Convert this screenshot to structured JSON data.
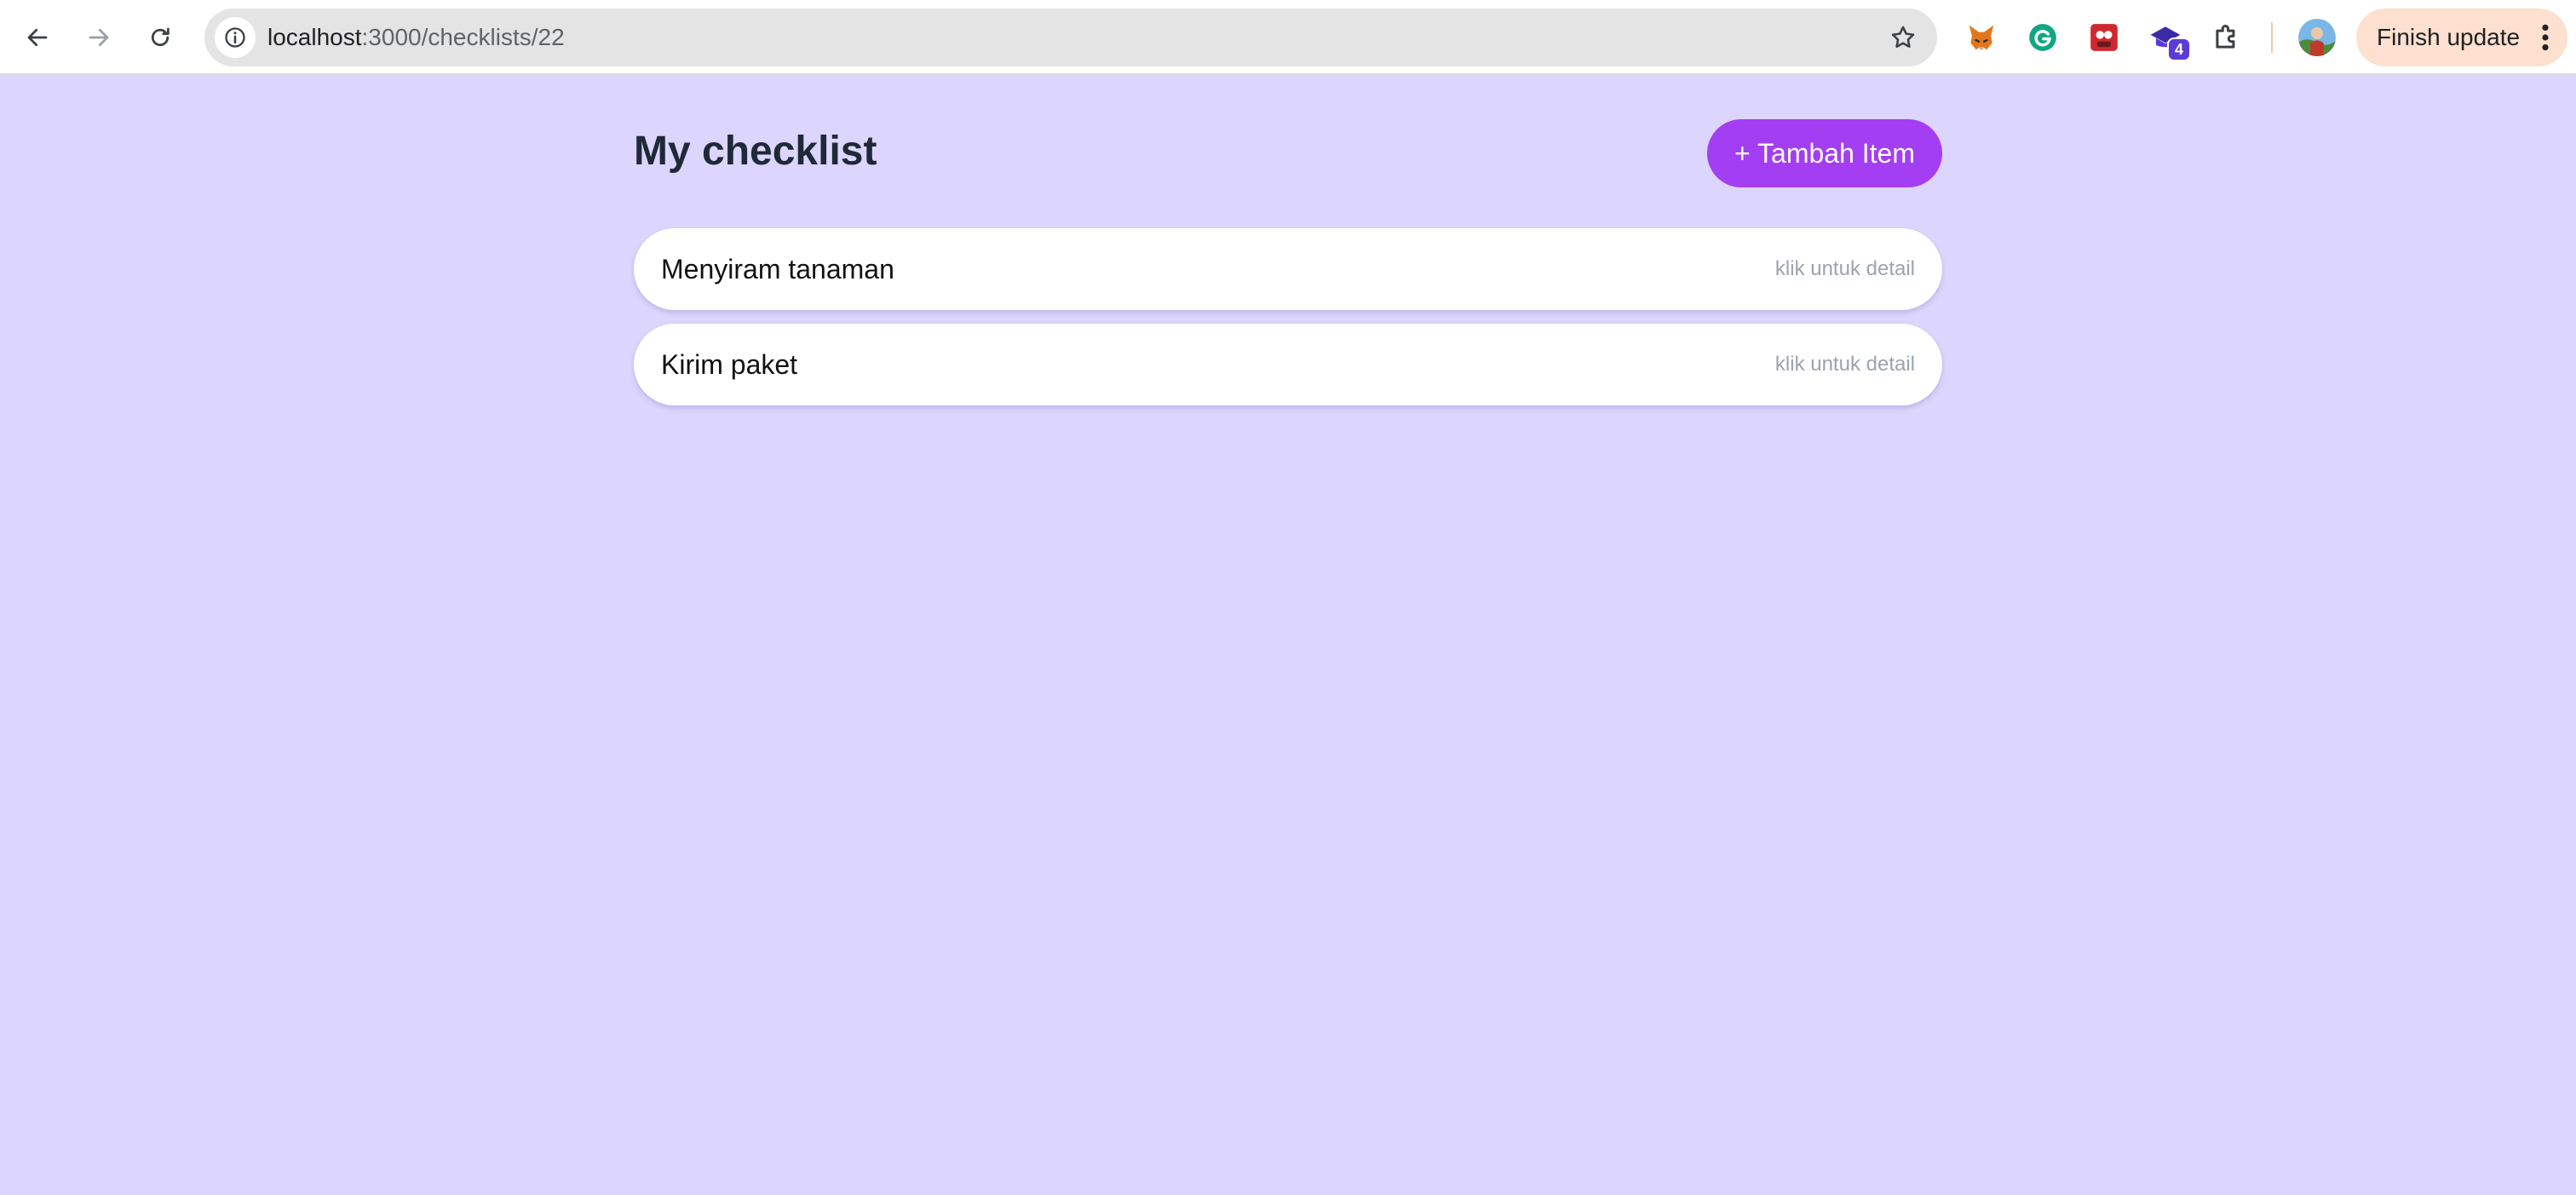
{
  "browser": {
    "url_host": "localhost",
    "url_path": ":3000/checklists/22",
    "extensions": [
      {
        "name": "metamask-extension",
        "icon": "fox-icon"
      },
      {
        "name": "grammarly-extension",
        "icon": "grammarly-icon"
      },
      {
        "name": "red-extension",
        "icon": "red-app-icon"
      },
      {
        "name": "purple-extension",
        "icon": "graduation-cap-icon",
        "badge": "4"
      },
      {
        "name": "extensions-menu",
        "icon": "puzzle-icon"
      }
    ],
    "finish_update_label": "Finish update",
    "colors": {
      "toolbar_bg": "#ffffff",
      "omnibox_bg": "#e4e4e4",
      "finish_update_bg": "#fde0cf"
    }
  },
  "page": {
    "title": "My checklist",
    "add_button_label": "+ Tambah Item",
    "items": [
      {
        "title": "Menyiram tanaman",
        "hint": "klik untuk detail"
      },
      {
        "title": "Kirim paket",
        "hint": "klik untuk detail"
      }
    ],
    "colors": {
      "background": "#dcd5fd",
      "accent": "#a33ef2",
      "card": "#ffffff",
      "hint_text": "#9ca3af"
    }
  }
}
